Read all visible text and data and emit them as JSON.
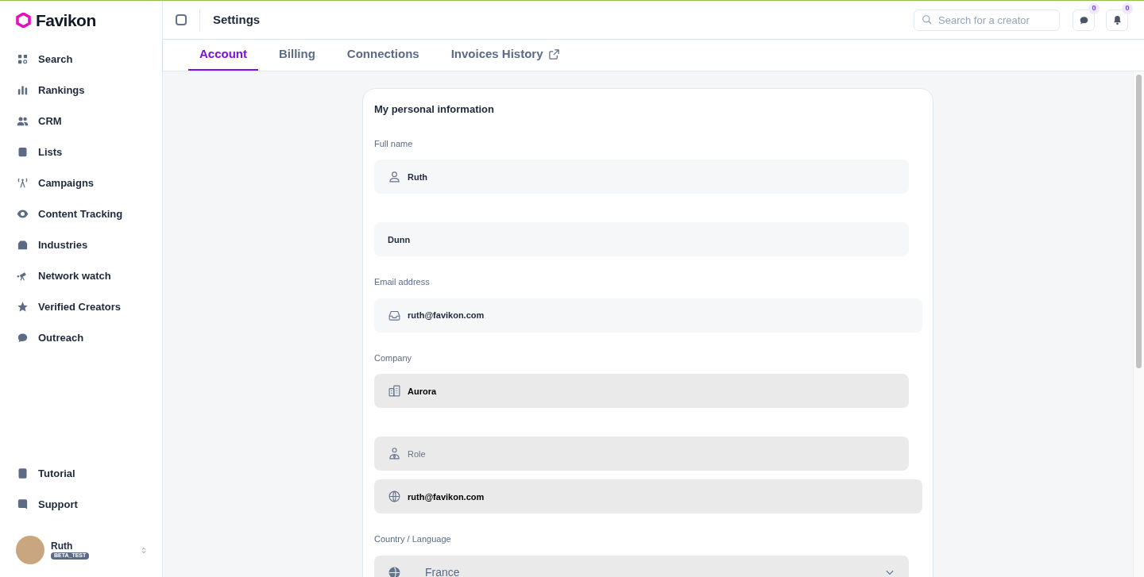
{
  "brand": {
    "name": "Favikon"
  },
  "sidebar": {
    "items": [
      {
        "label": "Search"
      },
      {
        "label": "Rankings"
      },
      {
        "label": "CRM"
      },
      {
        "label": "Lists"
      },
      {
        "label": "Campaigns"
      },
      {
        "label": "Content Tracking"
      },
      {
        "label": "Industries"
      },
      {
        "label": "Network watch"
      },
      {
        "label": "Verified Creators"
      },
      {
        "label": "Outreach"
      }
    ],
    "bottom_items": [
      {
        "label": "Tutorial"
      },
      {
        "label": "Support"
      }
    ],
    "user": {
      "name": "Ruth",
      "badge": "BETA_TEST"
    }
  },
  "header": {
    "title": "Settings",
    "search": {
      "placeholder": "Search for a creator"
    },
    "messages_count": "0",
    "notifications_count": "0"
  },
  "tabs": [
    {
      "label": "Account",
      "selected": true,
      "kind": "tab"
    },
    {
      "label": "Billing",
      "selected": false,
      "kind": "tab"
    },
    {
      "label": "Connections",
      "selected": false,
      "kind": "tab"
    },
    {
      "label": "Invoices History",
      "selected": false,
      "kind": "link"
    }
  ],
  "card": {
    "title": "My personal information",
    "sections": [
      {
        "label": "Full name",
        "fields": [
          {
            "kind": "input",
            "value": "Ruth",
            "disabled": false
          },
          {
            "kind": "input",
            "value": "Dunn",
            "disabled": false
          }
        ]
      },
      {
        "label": "Email address",
        "fields": [
          {
            "kind": "input",
            "value": "ruth@favikon.com",
            "disabled": false
          }
        ]
      },
      {
        "label": "Company",
        "fields": [
          {
            "kind": "input",
            "value": "Aurora",
            "disabled": true
          },
          {
            "kind": "input",
            "placeholder": "Role",
            "disabled": true
          },
          {
            "kind": "input",
            "value": "ruth@favikon.com",
            "disabled": true
          }
        ]
      },
      {
        "label": "Country / Language",
        "fields": [
          {
            "kind": "select",
            "value": "France",
            "disabled": true
          }
        ]
      }
    ]
  }
}
